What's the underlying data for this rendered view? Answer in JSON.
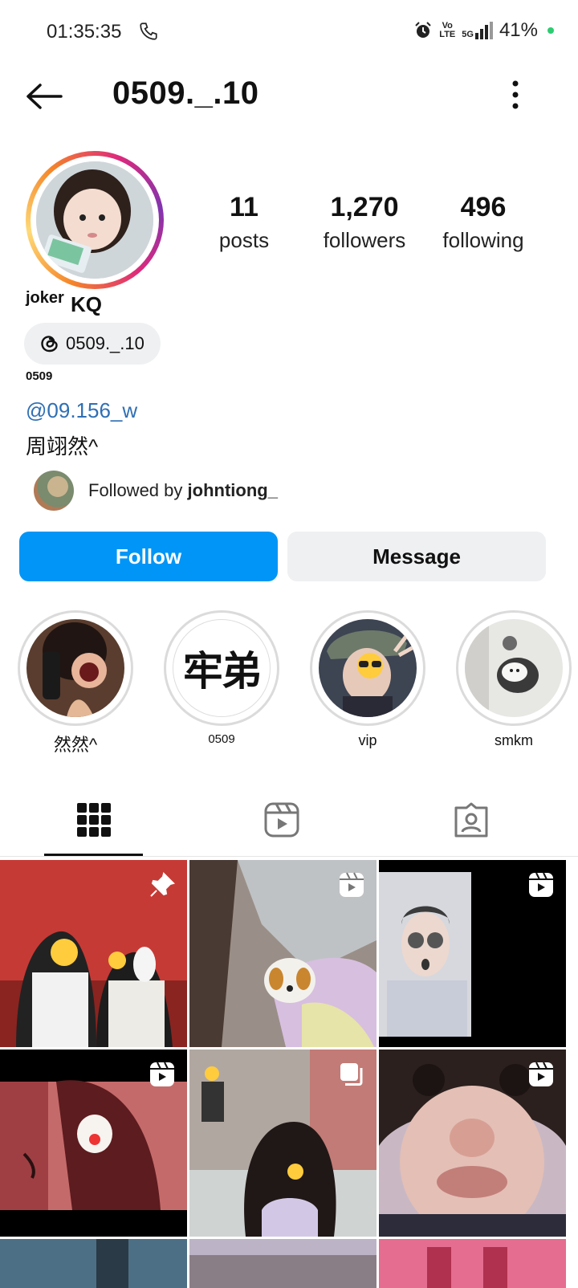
{
  "status": {
    "time": "01:35:35",
    "battery": "41%",
    "net_top": "Vo",
    "net_bottom": "LTE",
    "net_5g": "5G"
  },
  "header": {
    "username": "0509._.10"
  },
  "stats": {
    "posts": {
      "value": "11",
      "label": "posts"
    },
    "followers": {
      "value": "1,270",
      "label": "followers"
    },
    "following": {
      "value": "496",
      "label": "following"
    }
  },
  "profile": {
    "name_small": "joker",
    "name_big": "KQ",
    "threads_handle": "0509._.10",
    "category": "0509",
    "mention": "@09.156_w",
    "bio": "周翊然^",
    "followed_by_prefix": "Followed by ",
    "followed_by_user": "johntiong_"
  },
  "buttons": {
    "follow": "Follow",
    "message": "Message"
  },
  "highlights": [
    {
      "label": "然然^"
    },
    {
      "label": "0509",
      "cover_text": "牢弟"
    },
    {
      "label": "vip"
    },
    {
      "label": "smkm"
    }
  ],
  "colors": {
    "accent": "#0095f6",
    "link": "#2f6fb4"
  }
}
